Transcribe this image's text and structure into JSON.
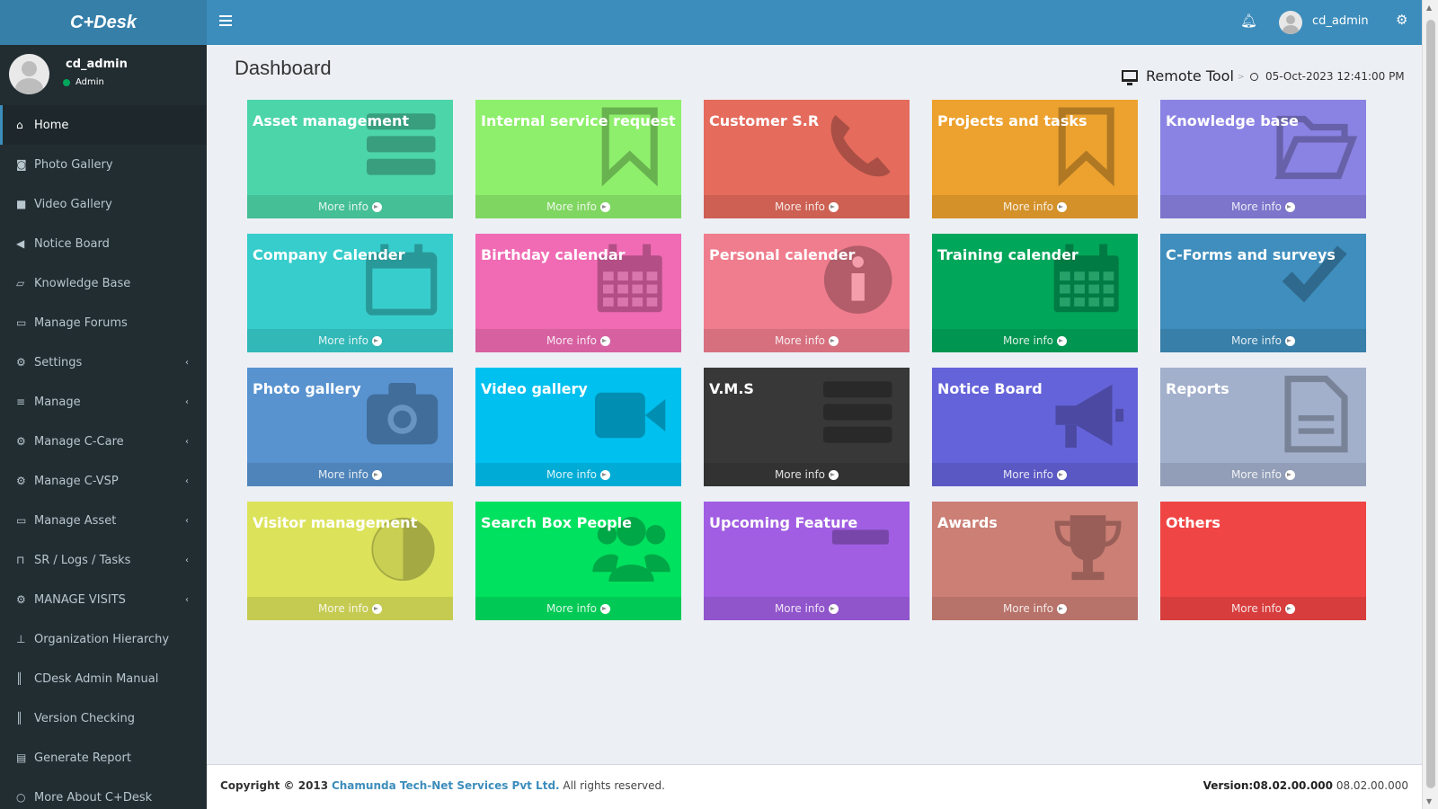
{
  "app": {
    "logo": "C+Desk"
  },
  "topbar": {
    "username": "cd_admin",
    "icons": [
      "menu-icon",
      "bell-icon",
      "user-avatar",
      "gears-icon"
    ]
  },
  "sidebar": {
    "user": {
      "name": "cd_admin",
      "role": "Admin",
      "status_color": "#00a65a"
    },
    "items": [
      {
        "label": "Home",
        "icon": "home-icon",
        "active": true
      },
      {
        "label": "Photo Gallery",
        "icon": "camera-icon"
      },
      {
        "label": "Video Gallery",
        "icon": "video-icon"
      },
      {
        "label": "Notice Board",
        "icon": "bullhorn-icon"
      },
      {
        "label": "Knowledge Base",
        "icon": "folder-open-icon"
      },
      {
        "label": "Manage Forums",
        "icon": "folder-icon"
      },
      {
        "label": "Settings",
        "icon": "gears-icon",
        "expandable": true
      },
      {
        "label": "Manage",
        "icon": "list-icon",
        "expandable": true
      },
      {
        "label": "Manage C-Care",
        "icon": "gears-icon",
        "expandable": true
      },
      {
        "label": "Manage C-VSP",
        "icon": "gears-icon",
        "expandable": true
      },
      {
        "label": "Manage Asset",
        "icon": "laptop-icon",
        "expandable": true
      },
      {
        "label": "SR / Logs / Tasks",
        "icon": "bookmark-icon",
        "expandable": true
      },
      {
        "label": "MANAGE VISITS",
        "icon": "gears-icon",
        "expandable": true
      },
      {
        "label": "Organization Hierarchy",
        "icon": "sitemap-icon"
      },
      {
        "label": "CDesk Admin Manual",
        "icon": "barcode-icon"
      },
      {
        "label": "Version Checking",
        "icon": "barcode-icon"
      },
      {
        "label": "Generate Report",
        "icon": "book-icon"
      },
      {
        "label": "More About C+Desk",
        "icon": "circle-icon"
      }
    ]
  },
  "page": {
    "title": "Dashboard",
    "remote_tool": "Remote Tool",
    "datetime": "05-Oct-2023 12:41:00 PM"
  },
  "tiles": [
    {
      "title": "Asset management",
      "color": "#4cd5a8",
      "icon": "server-icon",
      "footer": "More info"
    },
    {
      "title": "Internal service request",
      "color": "#8eef6c",
      "icon": "bookmark-icon",
      "footer": "More info"
    },
    {
      "title": "Customer S.R",
      "color": "#e56b5d",
      "icon": "phone-icon",
      "footer": "More info"
    },
    {
      "title": "Projects and tasks",
      "color": "#eda22f",
      "icon": "bookmark-icon",
      "footer": "More info"
    },
    {
      "title": "Knowledge base",
      "color": "#8b83e3",
      "icon": "folder-open-icon",
      "footer": "More info"
    },
    {
      "title": "Company Calender",
      "color": "#37cdcc",
      "icon": "calendar-icon",
      "footer": "More info"
    },
    {
      "title": "Birthday calendar",
      "color": "#f06bb4",
      "icon": "calendar-grid-icon",
      "footer": "More info"
    },
    {
      "title": "Personal calender",
      "color": "#ef7d8e",
      "icon": "info-icon",
      "footer": "More info"
    },
    {
      "title": "Training calender",
      "color": "#00a65a",
      "icon": "calendar-grid-icon",
      "footer": "More info"
    },
    {
      "title": "C-Forms and surveys",
      "color": "#3f8ebd",
      "icon": "check-icon",
      "footer": "More info"
    },
    {
      "title": "Photo gallery",
      "color": "#5893d0",
      "icon": "camera-icon",
      "footer": "More info"
    },
    {
      "title": "Video gallery",
      "color": "#00c0ef",
      "icon": "video-icon",
      "footer": "More info"
    },
    {
      "title": "V.M.S",
      "color": "#383838",
      "icon": "server-icon",
      "footer": "More info"
    },
    {
      "title": "Notice Board",
      "color": "#6563da",
      "icon": "bullhorn-icon",
      "footer": "More info"
    },
    {
      "title": "Reports",
      "color": "#a3b0cc",
      "icon": "file-icon",
      "footer": "More info"
    },
    {
      "title": "Visitor management",
      "color": "#dce35b",
      "icon": "half-circle-icon",
      "footer": "More info"
    },
    {
      "title": "Search Box People",
      "color": "#00e15f",
      "icon": "users-icon",
      "footer": "More info"
    },
    {
      "title": "Upcoming Feature",
      "color": "#a15ee2",
      "icon": "minus-icon",
      "footer": "More info"
    },
    {
      "title": "Awards",
      "color": "#cc7f75",
      "icon": "trophy-icon",
      "footer": "More info"
    },
    {
      "title": "Others",
      "color": "#f04545",
      "icon": "none",
      "footer": "More info"
    }
  ],
  "footer": {
    "copyright_prefix": "Copyright © 2013",
    "company": "Chamunda Tech-Net Services Pvt Ltd.",
    "rights": "All rights reserved.",
    "version_label": "Version:08.02.00.000",
    "version_value": "08.02.00.000"
  }
}
